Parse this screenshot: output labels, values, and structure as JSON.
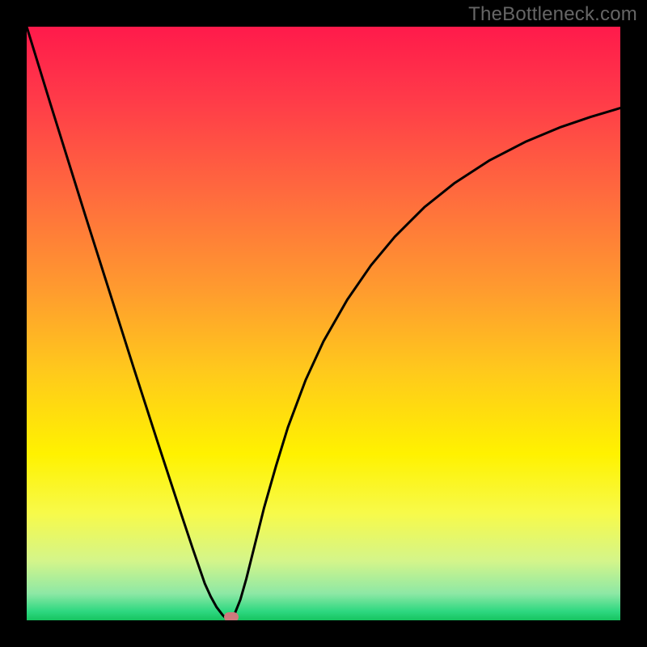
{
  "watermark": "TheBottleneck.com",
  "gradient": {
    "stops": [
      {
        "offset": 0.0,
        "color": "#ff1a4b"
      },
      {
        "offset": 0.12,
        "color": "#ff3a49"
      },
      {
        "offset": 0.28,
        "color": "#ff6a3e"
      },
      {
        "offset": 0.44,
        "color": "#ff9a2f"
      },
      {
        "offset": 0.58,
        "color": "#ffc91c"
      },
      {
        "offset": 0.72,
        "color": "#fff200"
      },
      {
        "offset": 0.82,
        "color": "#f7fa4a"
      },
      {
        "offset": 0.9,
        "color": "#d4f58a"
      },
      {
        "offset": 0.955,
        "color": "#8de8a5"
      },
      {
        "offset": 0.985,
        "color": "#2ed880"
      },
      {
        "offset": 1.0,
        "color": "#17c45f"
      }
    ]
  },
  "chart_data": {
    "type": "line",
    "title": "",
    "xlabel": "",
    "ylabel": "",
    "xlim": [
      0,
      1
    ],
    "ylim": [
      0,
      1
    ],
    "x": [
      0.0,
      0.02,
      0.04,
      0.06,
      0.08,
      0.1,
      0.12,
      0.14,
      0.16,
      0.18,
      0.2,
      0.22,
      0.24,
      0.26,
      0.28,
      0.3,
      0.31,
      0.32,
      0.33,
      0.335,
      0.34,
      0.345,
      0.35,
      0.36,
      0.37,
      0.38,
      0.4,
      0.42,
      0.44,
      0.47,
      0.5,
      0.54,
      0.58,
      0.62,
      0.67,
      0.72,
      0.78,
      0.84,
      0.9,
      0.95,
      1.0
    ],
    "y": [
      1.0,
      0.935,
      0.87,
      0.806,
      0.742,
      0.678,
      0.615,
      0.552,
      0.489,
      0.426,
      0.364,
      0.302,
      0.241,
      0.18,
      0.12,
      0.062,
      0.04,
      0.022,
      0.009,
      0.004,
      0.0,
      0.003,
      0.01,
      0.035,
      0.07,
      0.11,
      0.19,
      0.26,
      0.325,
      0.405,
      0.47,
      0.54,
      0.598,
      0.646,
      0.696,
      0.736,
      0.775,
      0.806,
      0.831,
      0.848,
      0.863
    ],
    "marker": {
      "x": 0.345,
      "y": 0.005
    }
  }
}
